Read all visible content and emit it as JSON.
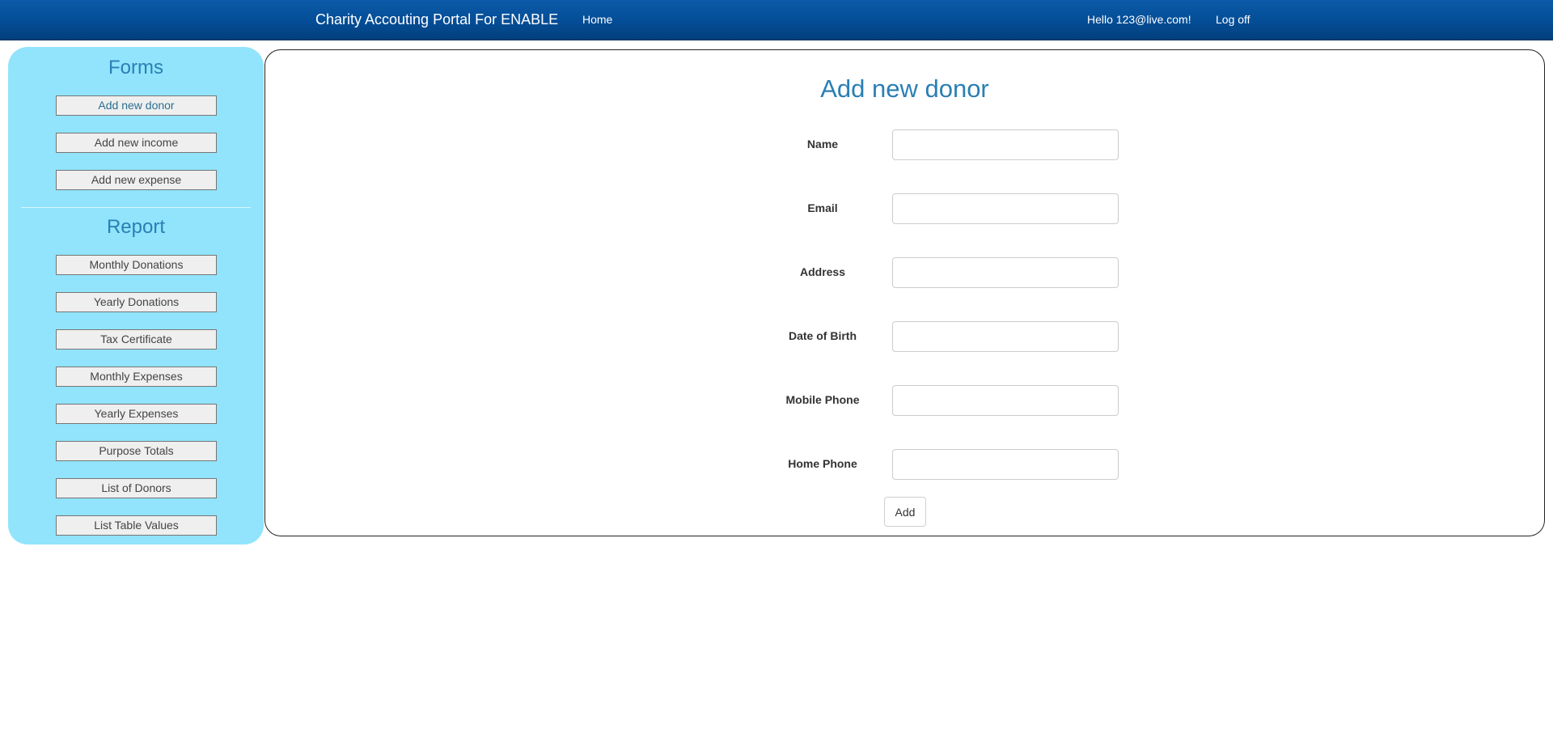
{
  "header": {
    "brand": "Charity Accouting Portal For ENABLE",
    "nav_home": "Home",
    "greeting": "Hello 123@live.com!",
    "logoff": "Log off",
    "background_color": "#044d96"
  },
  "sidebar": {
    "background_color": "#91e4fb",
    "forms_heading": "Forms",
    "forms_items": [
      {
        "label": "Add new donor"
      },
      {
        "label": "Add new income"
      },
      {
        "label": "Add new expense"
      }
    ],
    "report_heading": "Report",
    "report_items": [
      {
        "label": "Monthly Donations"
      },
      {
        "label": "Yearly Donations"
      },
      {
        "label": "Tax Certificate"
      },
      {
        "label": "Monthly Expenses"
      },
      {
        "label": "Yearly Expenses"
      },
      {
        "label": "Purpose Totals"
      },
      {
        "label": "List of Donors"
      },
      {
        "label": "List Table Values"
      }
    ]
  },
  "form": {
    "title": "Add new donor",
    "title_color": "#2a7fb5",
    "fields": [
      {
        "label": "Name",
        "value": ""
      },
      {
        "label": "Email",
        "value": ""
      },
      {
        "label": "Address",
        "value": ""
      },
      {
        "label": "Date of Birth",
        "value": ""
      },
      {
        "label": "Mobile Phone",
        "value": ""
      },
      {
        "label": "Home Phone",
        "value": ""
      }
    ],
    "submit_label": "Add"
  }
}
